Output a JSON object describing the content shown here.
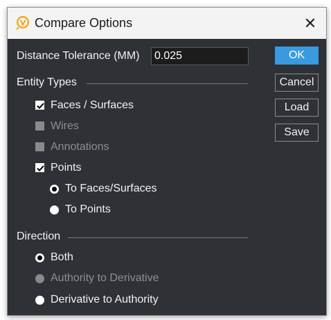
{
  "dialog": {
    "title": "Compare Options",
    "close_glyph": "✕",
    "app_icon": "v-logo-icon",
    "accent_color": "#3a9ae0"
  },
  "tolerance": {
    "label": "Distance Tolerance (MM)",
    "value": "0.025"
  },
  "buttons": {
    "ok": "OK",
    "cancel": "Cancel",
    "load": "Load",
    "save": "Save"
  },
  "entity_types": {
    "heading": "Entity Types",
    "faces": {
      "label": "Faces / Surfaces",
      "checked": true,
      "enabled": true
    },
    "wires": {
      "label": "Wires",
      "checked": false,
      "enabled": false
    },
    "annotations": {
      "label": "Annotations",
      "checked": false,
      "enabled": false
    },
    "points": {
      "label": "Points",
      "checked": true,
      "enabled": true
    },
    "points_options": [
      {
        "label": "To Faces/Surfaces",
        "selected": true,
        "enabled": true
      },
      {
        "label": "To Points",
        "selected": false,
        "enabled": true
      }
    ]
  },
  "direction": {
    "heading": "Direction",
    "options": [
      {
        "label": "Both",
        "selected": true,
        "enabled": true
      },
      {
        "label": "Authority to Derivative",
        "selected": false,
        "enabled": false
      },
      {
        "label": "Derivative to Authority",
        "selected": false,
        "enabled": true
      }
    ]
  }
}
